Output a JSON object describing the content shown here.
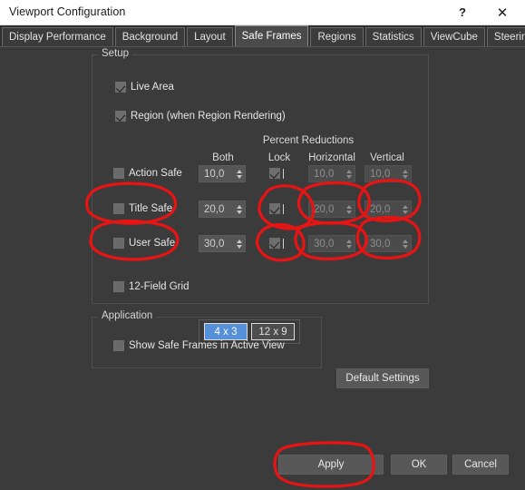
{
  "window": {
    "title": "Viewport Configuration",
    "help_label": "?",
    "close_label": "✕"
  },
  "tabs": [
    {
      "label": "Display Performance",
      "active": false
    },
    {
      "label": "Background",
      "active": false
    },
    {
      "label": "Layout",
      "active": false
    },
    {
      "label": "Safe Frames",
      "active": true
    },
    {
      "label": "Regions",
      "active": false
    },
    {
      "label": "Statistics",
      "active": false
    },
    {
      "label": "ViewCube",
      "active": false
    },
    {
      "label": "SteeringWheels",
      "active": false
    }
  ],
  "setup": {
    "legend": "Setup",
    "live_area": {
      "label": "Live Area",
      "checked": true
    },
    "region": {
      "label": "Region (when Region Rendering)",
      "checked": true
    },
    "percent_reductions_label": "Percent Reductions",
    "columns": {
      "both": "Both",
      "lock": "Lock",
      "horizontal": "Horizontal",
      "vertical": "Vertical"
    },
    "rows": [
      {
        "label": "Action Safe",
        "checked": false,
        "both": "10,0",
        "lock": true,
        "horizontal": "10,0",
        "vertical": "10,0",
        "hv_disabled": true
      },
      {
        "label": "Title Safe",
        "checked": false,
        "both": "20,0",
        "lock": true,
        "horizontal": "20,0",
        "vertical": "20,0",
        "hv_disabled": true
      },
      {
        "label": "User Safe",
        "checked": false,
        "both": "30,0",
        "lock": true,
        "horizontal": "30,0",
        "vertical": "30,0",
        "hv_disabled": true
      }
    ],
    "field_grid": {
      "label": "12-Field Grid",
      "checked": false,
      "option_a": "4 x 3",
      "option_b": "12 x 9",
      "selected": "4 x 3"
    }
  },
  "application": {
    "legend": "Application",
    "show_safe_frames": {
      "label": "Show Safe Frames in Active View",
      "checked": false
    }
  },
  "buttons": {
    "default_settings": "Default Settings",
    "apply": "Apply",
    "ok": "OK",
    "cancel": "Cancel"
  },
  "colors": {
    "dialog_bg": "#3b3b3b",
    "titlebar_bg": "#ffffff",
    "tab_active_bg": "#4a4a4a",
    "accent_blue": "#5590d8",
    "annotation_red": "#e81414"
  },
  "annotations": {
    "color": "#e81414",
    "note": "hand-drawn red circles highlighting Title Safe / User Safe checkboxes, their Lock checkboxes, Horizontal and Vertical spinners, and the Apply button"
  }
}
